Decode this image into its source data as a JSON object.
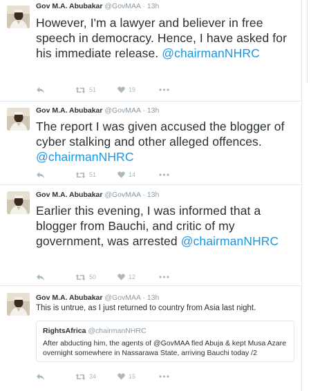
{
  "tweets": [
    {
      "name": "Gov M.A. Abubakar",
      "handle": "@GovMAA",
      "dot": "·",
      "time": "13h",
      "text": "However, I'm a lawyer and believer in free speech in democracy. Hence, I have asked for his immediate release.",
      "mention": "@chairmanNHRC",
      "retweets": "51",
      "likes": "19"
    },
    {
      "name": "Gov M.A. Abubakar",
      "handle": "@GovMAA",
      "dot": "·",
      "time": "13h",
      "text": "The report I was given accused the blogger of cyber stalking and other alleged offences.",
      "mention": "@chairmanNHRC",
      "retweets": "51",
      "likes": "14"
    },
    {
      "name": "Gov M.A. Abubakar",
      "handle": "@GovMAA",
      "dot": "·",
      "time": "13h",
      "text": "Earlier this evening, I was informed that a blogger from Bauchi, and critic of my government, was arrested",
      "mention": "@chairmanNHRC",
      "retweets": "50",
      "likes": "12"
    },
    {
      "name": "Gov M.A. Abubakar",
      "handle": "@GovMAA",
      "dot": "·",
      "time": "13h",
      "text": "This is untrue, as I just returned to country from Asia last night.",
      "retweets": "34",
      "likes": "15",
      "quote": {
        "name": "RightsAfrica",
        "handle": "@chairmanNHRC",
        "text": "After abducting him, the agents of @GovMAA fled Abuja & kept Musa Azare overnight somewhere in Nassarawa State, arriving Bauchi today /2"
      }
    }
  ],
  "icons": {
    "reply": "reply-icon",
    "retweet": "retweet-icon",
    "like": "heart-icon",
    "more": "more-icon",
    "avatar": "avatar"
  },
  "colors": {
    "text": "#292f33",
    "muted": "#8899a6",
    "link": "#1b95e0",
    "action": "#aab8c2",
    "border": "#e1e8ed"
  }
}
